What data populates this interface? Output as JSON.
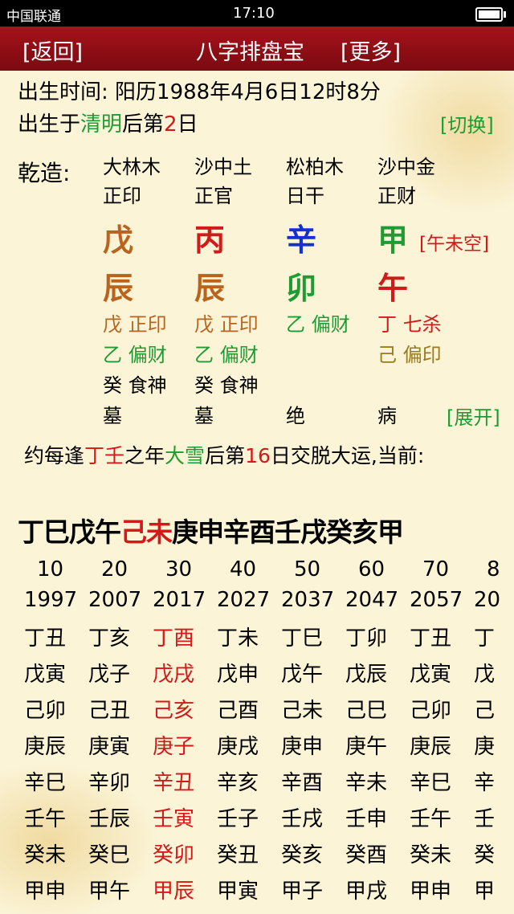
{
  "status": {
    "carrier": "中国联通",
    "time": "17:10"
  },
  "header": {
    "back_label": "[返回]",
    "title": "八字排盘宝",
    "more_label": "[更多]"
  },
  "birth": {
    "time_label": "出生时间: 阳历1988年4月6日12时8分",
    "solar_prefix": "出生于",
    "solar_term": "清明",
    "solar_mid": "后第",
    "solar_day": "2",
    "solar_suffix": "日",
    "switch_label": "[切换]"
  },
  "chart": {
    "label": "乾造:",
    "nayin": [
      "大林木",
      "沙中土",
      "松柏木",
      "沙中金"
    ],
    "ten_gods": [
      "正印",
      "正官",
      "日干",
      "正财"
    ],
    "stems": [
      "戊",
      "丙",
      "辛",
      "甲"
    ],
    "branches": [
      "辰",
      "辰",
      "卯",
      "午"
    ],
    "kongwang": "[午未空]",
    "hidden": {
      "row1": [
        "戊 正印",
        "戊 正印",
        "乙 偏财",
        "丁 七杀"
      ],
      "row2": [
        "乙 偏财",
        "乙 偏财",
        "",
        "己 偏印"
      ],
      "row3": [
        "癸 食神",
        "癸 食神",
        "",
        ""
      ]
    },
    "stages": [
      "墓",
      "墓",
      "绝",
      "病"
    ],
    "expand_label": "[展开]",
    "colors": {
      "stem_brown": "#b8641e",
      "stem_red": "#d21a1a",
      "stem_blue": "#1530d0",
      "stem_green": "#1f9b33"
    }
  },
  "luck": {
    "prefix": "约每逢",
    "stems": "丁壬",
    "mid1": "之年",
    "term": "大雪",
    "mid2": "后第",
    "day": "16",
    "suffix": "日交脱大运,当前:"
  },
  "dayun": {
    "before": "丁巳戊午",
    "current": "己未",
    "after": "庚申辛酉壬戌癸亥甲"
  },
  "table": {
    "ages": [
      "10",
      "20",
      "30",
      "40",
      "50",
      "60",
      "70",
      "8"
    ],
    "years": [
      "1997",
      "2007",
      "2017",
      "2027",
      "2037",
      "2047",
      "2057",
      "20"
    ],
    "rows": [
      [
        "丁丑",
        "丁亥",
        "丁酉",
        "丁未",
        "丁巳",
        "丁卯",
        "丁丑",
        "丁"
      ],
      [
        "戊寅",
        "戊子",
        "戊戌",
        "戊申",
        "戊午",
        "戊辰",
        "戊寅",
        "戊"
      ],
      [
        "己卯",
        "己丑",
        "己亥",
        "己酉",
        "己未",
        "己巳",
        "己卯",
        "己"
      ],
      [
        "庚辰",
        "庚寅",
        "庚子",
        "庚戌",
        "庚申",
        "庚午",
        "庚辰",
        "庚"
      ],
      [
        "辛巳",
        "辛卯",
        "辛丑",
        "辛亥",
        "辛酉",
        "辛未",
        "辛巳",
        "辛"
      ],
      [
        "壬午",
        "壬辰",
        "壬寅",
        "壬子",
        "壬戌",
        "壬申",
        "壬午",
        "壬"
      ],
      [
        "癸未",
        "癸巳",
        "癸卯",
        "癸丑",
        "癸亥",
        "癸酉",
        "癸未",
        "癸"
      ],
      [
        "甲申",
        "甲午",
        "甲辰",
        "甲寅",
        "甲子",
        "甲戌",
        "甲申",
        "甲"
      ]
    ],
    "highlight_column": 2
  }
}
